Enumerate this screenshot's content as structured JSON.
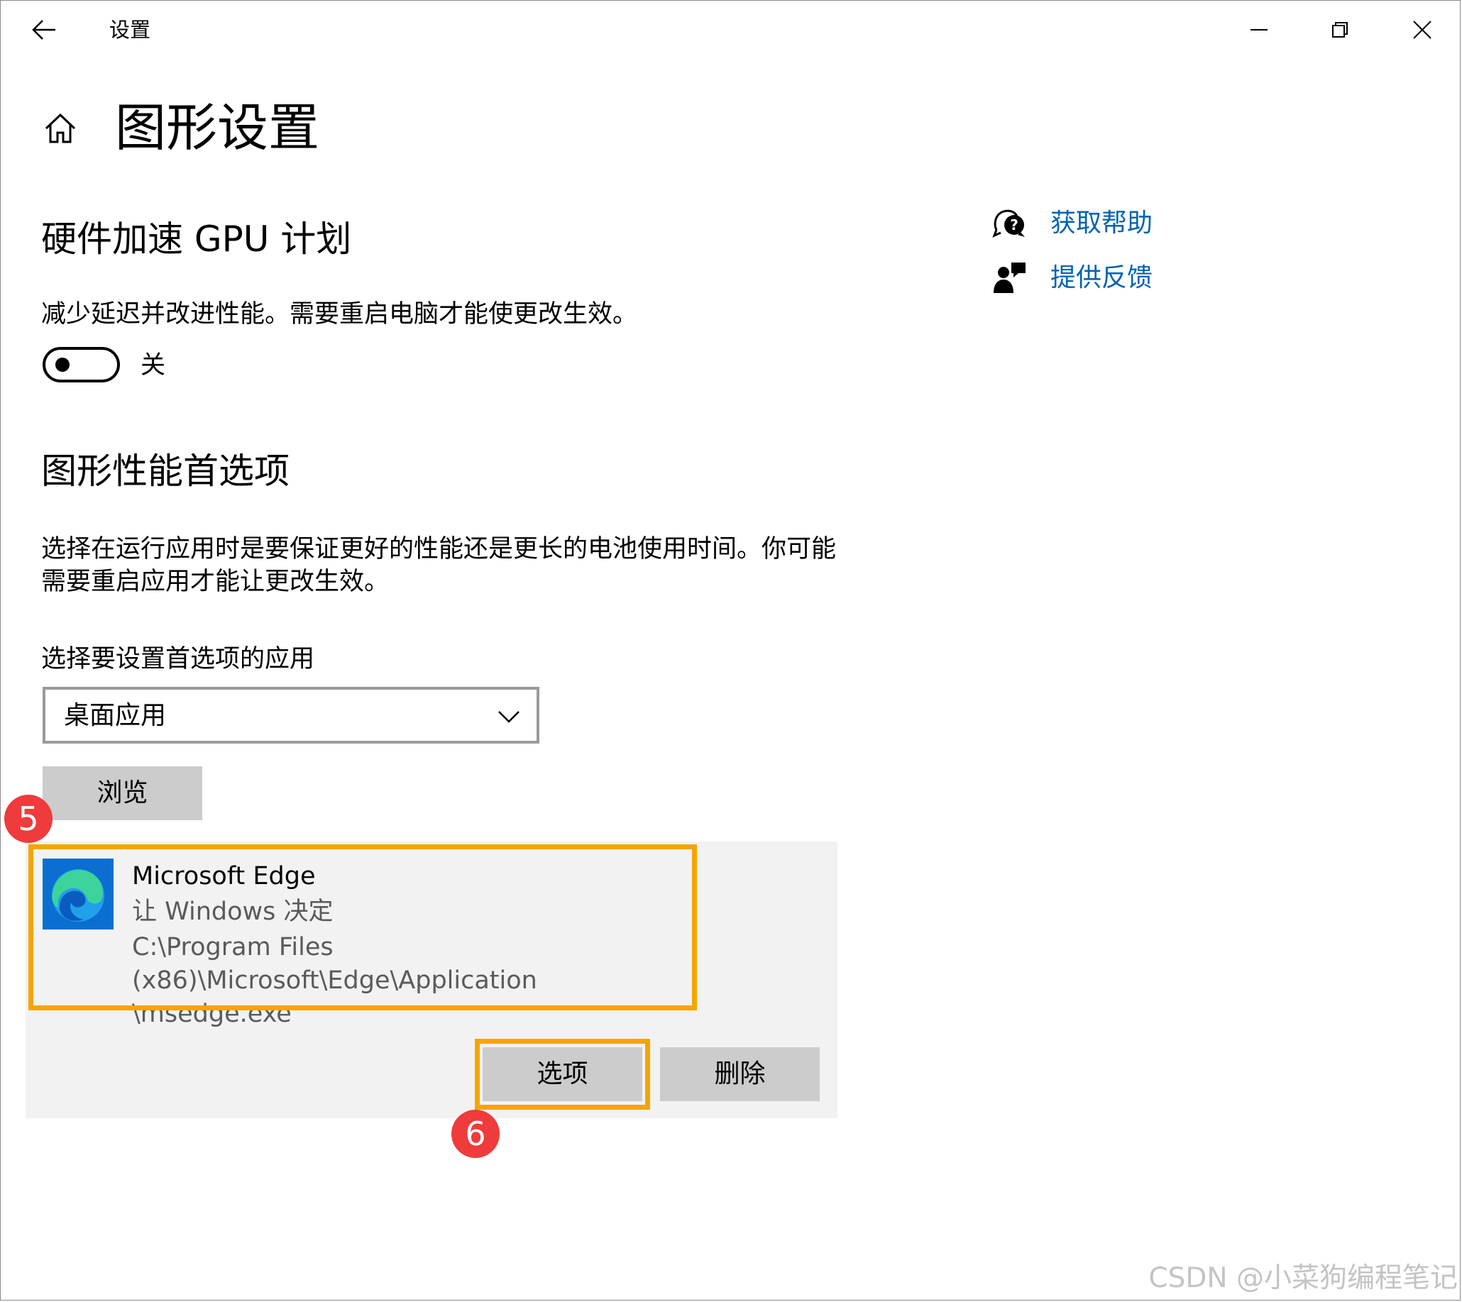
{
  "window": {
    "title": "设置"
  },
  "page": {
    "title": "图形设置"
  },
  "gpu": {
    "heading": "硬件加速 GPU 计划",
    "description": "减少延迟并改进性能。需要重启电脑才能使更改生效。",
    "toggle_state": "关",
    "toggle_on": false
  },
  "perf": {
    "heading": "图形性能首选项",
    "description_line1": "选择在运行应用时是要保证更好的性能还是更长的电池使用时间。你可能",
    "description_line2": "需要重启应用才能让更改生效。",
    "select_label": "选择要设置首选项的应用",
    "dropdown_value": "桌面应用",
    "browse_label": "浏览"
  },
  "links": {
    "help": "获取帮助",
    "feedback": "提供反馈"
  },
  "app": {
    "name": "Microsoft Edge",
    "setting": "让 Windows 决定",
    "path_line1": "C:\\Program Files (x86)\\Microsoft\\Edge\\Application",
    "path_line2": "\\msedge.exe",
    "options_label": "选项",
    "remove_label": "删除"
  },
  "annotations": {
    "marker1": "5",
    "marker2": "6"
  },
  "watermark": "CSDN @小菜狗编程笔记",
  "colors": {
    "link": "#0063b1",
    "highlight": "#f5a500",
    "marker": "#ef3b3b",
    "button": "#cccccc"
  }
}
